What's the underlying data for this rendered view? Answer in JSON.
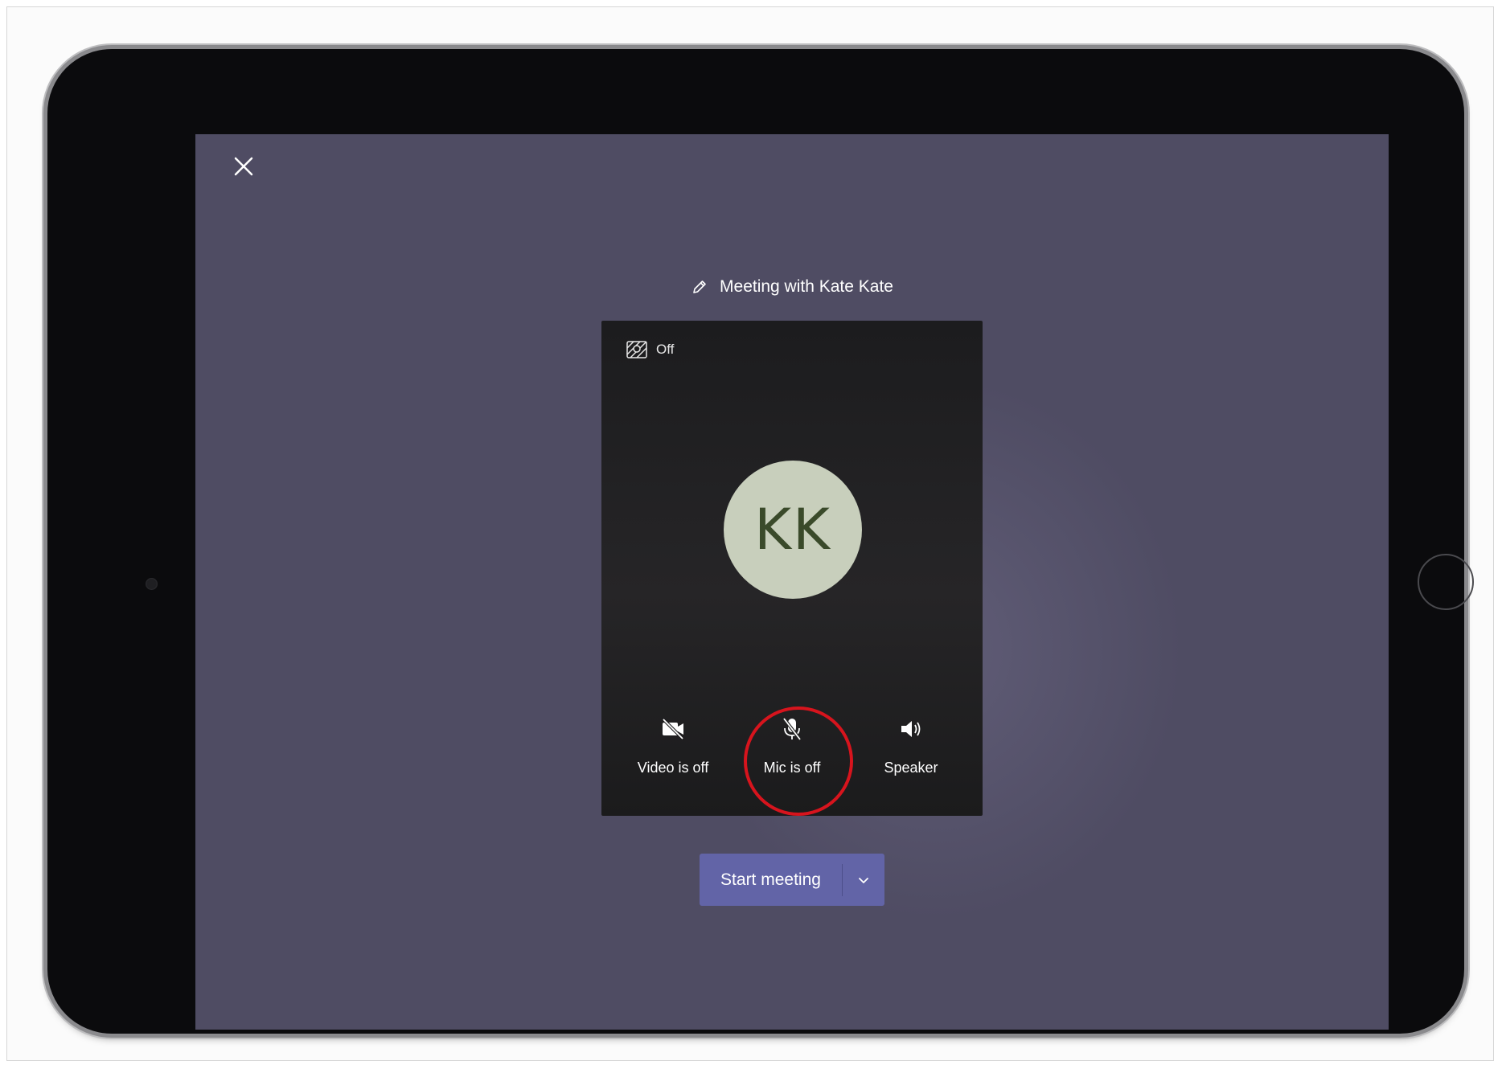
{
  "meeting": {
    "title": "Meeting with Kate Kate"
  },
  "background_effect": {
    "label": "Off",
    "icon": "background-blur-icon"
  },
  "avatar": {
    "initials": "KK",
    "color": "#c8cfbc",
    "text_color": "#3a4a2a"
  },
  "controls": [
    {
      "label": "Video is off",
      "icon": "video-off-icon"
    },
    {
      "label": "Mic is off",
      "icon": "mic-off-icon"
    },
    {
      "label": "Speaker",
      "icon": "speaker-icon"
    }
  ],
  "start_button": {
    "label": "Start meeting",
    "dropdown_icon": "chevron-down-icon"
  },
  "colors": {
    "screen_bg": "#4f4c63",
    "accent": "#6264a7",
    "highlight": "#d7141d"
  },
  "icons": {
    "close": "close-icon",
    "edit": "pencil-icon"
  }
}
